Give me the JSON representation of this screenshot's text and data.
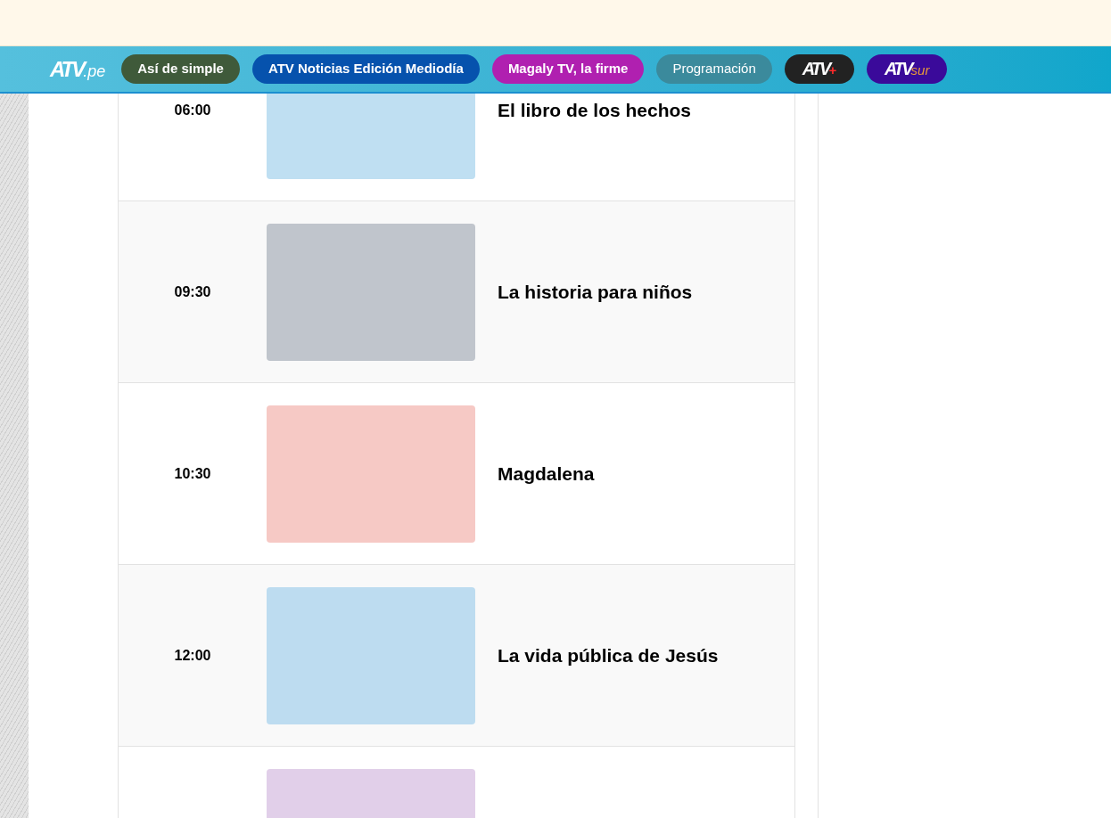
{
  "nav": [
    {
      "kind": "logo",
      "mark": "ATV",
      "suffix": ".pe"
    },
    {
      "kind": "pill",
      "label": "Así de simple",
      "color": "#3f5a3a"
    },
    {
      "kind": "pill",
      "label": "ATV Noticias Edición Mediodía",
      "color": "#0652ad"
    },
    {
      "kind": "pill",
      "label": "Magaly TV, la firme",
      "color": "#b020b0"
    },
    {
      "kind": "pill",
      "label": "Programación",
      "color": "#3b8a9c"
    },
    {
      "kind": "logo-pill",
      "mark": "ATV",
      "suffix": "+",
      "color": "#222222"
    },
    {
      "kind": "logo-pill",
      "mark": "ATV",
      "suffix": "sur",
      "color": "#3a0a9a"
    }
  ],
  "schedule": [
    {
      "time": "06:00",
      "title": "El libro de los hechos",
      "color": "#bfdff2"
    },
    {
      "time": "09:30",
      "title": "La historia para niños",
      "color": "#c0c5cc"
    },
    {
      "time": "10:30",
      "title": "Magdalena",
      "color": "#f6c9c5"
    },
    {
      "time": "12:00",
      "title": "La vida pública de Jesús",
      "color": "#bddcf0"
    },
    {
      "color": "#e1cfe9"
    }
  ]
}
